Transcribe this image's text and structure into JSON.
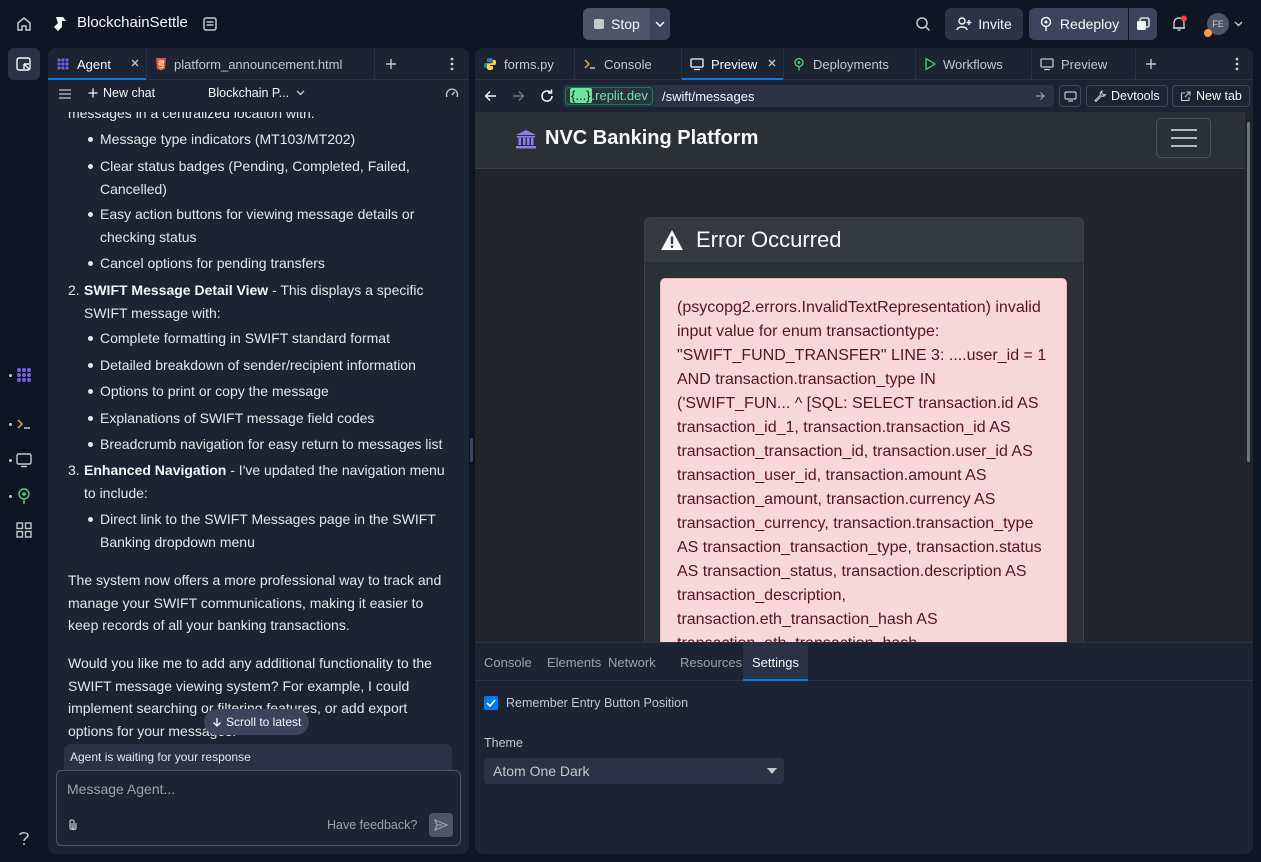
{
  "topbar": {
    "app_name": "BlockchainSettle",
    "stop_label": "Stop",
    "invite_label": "Invite",
    "redeploy_label": "Redeploy",
    "avatar_initials": "FE"
  },
  "left_panel": {
    "tabs": [
      {
        "label": "Agent",
        "icon": "agent-icon"
      },
      {
        "label": "platform_announcement.html",
        "icon": "html5-icon"
      }
    ],
    "toolbar": {
      "new_chat_label": "New chat",
      "chat_title": "Blockchain P..."
    },
    "chat": {
      "intro_tail": "messages in a centralized location with:",
      "list1": [
        "Message type indicators (MT103/MT202)",
        "Clear status badges (Pending, Completed, Failed, Cancelled)",
        "Easy action buttons for viewing message details or checking status",
        "Cancel options for pending transfers"
      ],
      "item2_num": "2.",
      "item2_title": "SWIFT Message Detail View",
      "item2_text": " - This displays a specific SWIFT message with:",
      "list2": [
        "Complete formatting in SWIFT standard format",
        "Detailed breakdown of sender/recipient information",
        "Options to print or copy the message",
        "Explanations of SWIFT message field codes",
        "Breadcrumb navigation for easy return to messages list"
      ],
      "item3_num": "3.",
      "item3_title": "Enhanced Navigation",
      "item3_text": " - I've updated the navigation menu to include:",
      "list3": [
        "Direct link to the SWIFT Messages page in the SWIFT Banking dropdown menu"
      ],
      "para1": "The system now offers a more professional way to track and manage your SWIFT communications, making it easier to keep records of all your banking transactions.",
      "para2": "Would you like me to add any additional functionality to the SWIFT message viewing system? For example, I could implement searching or filtering features, or add export options for your messages."
    },
    "scroll_latest_label": "Scroll to latest",
    "waiting_text": "Agent is waiting for your response",
    "composer": {
      "placeholder": "Message Agent...",
      "feedback_label": "Have feedback?"
    }
  },
  "right_panel": {
    "tabs": [
      {
        "label": "forms.py",
        "icon": "python-icon"
      },
      {
        "label": "Console",
        "icon": "terminal-icon"
      },
      {
        "label": "Preview",
        "icon": "monitor-icon"
      },
      {
        "label": "Deployments",
        "icon": "deploy-icon"
      },
      {
        "label": "Workflows",
        "icon": "play-icon"
      },
      {
        "label": "Preview",
        "icon": "monitor-icon"
      }
    ],
    "url": {
      "domain_brace": "{...}",
      "domain_suffix": ".replit.dev",
      "path": "/swift/messages"
    },
    "devtools_label": "Devtools",
    "new_tab_label": "New tab",
    "webpage": {
      "brand": "NVC Banking Platform",
      "error_title": "Error Occurred",
      "error_message": "(psycopg2.errors.InvalidTextRepresentation) invalid input value for enum transactiontype: \"SWIFT_FUND_TRANSFER\" LINE 3: ....user_id = 1 AND transaction.transaction_type IN ('SWIFT_FUN... ^ [SQL: SELECT transaction.id AS transaction_id_1, transaction.transaction_id AS transaction_transaction_id, transaction.user_id AS transaction_user_id, transaction.amount AS transaction_amount, transaction.currency AS transaction_currency, transaction.transaction_type AS transaction_transaction_type, transaction.status AS transaction_status, transaction.description AS transaction_description, transaction.eth_transaction_hash AS transaction_eth_transaction_hash, transaction.institution_id AS transaction_institution_id, transaction.gateway_id"
    },
    "devtools": {
      "tabs": [
        "Console",
        "Elements",
        "Network",
        "Resources",
        "Settings"
      ],
      "active_tab": "Settings",
      "checkbox_label": "Remember Entry Button Position",
      "theme_label": "Theme",
      "theme_value": "Atom One Dark"
    }
  },
  "colors": {
    "background": "#0e1525",
    "surface": "#1c2333",
    "accent": "#0079f2",
    "stop_button": "#4e5569",
    "url_domain": "#6be69c",
    "error_bg": "#f8d7da",
    "error_text": "#58151c",
    "agent_icon": "#795ee3"
  }
}
